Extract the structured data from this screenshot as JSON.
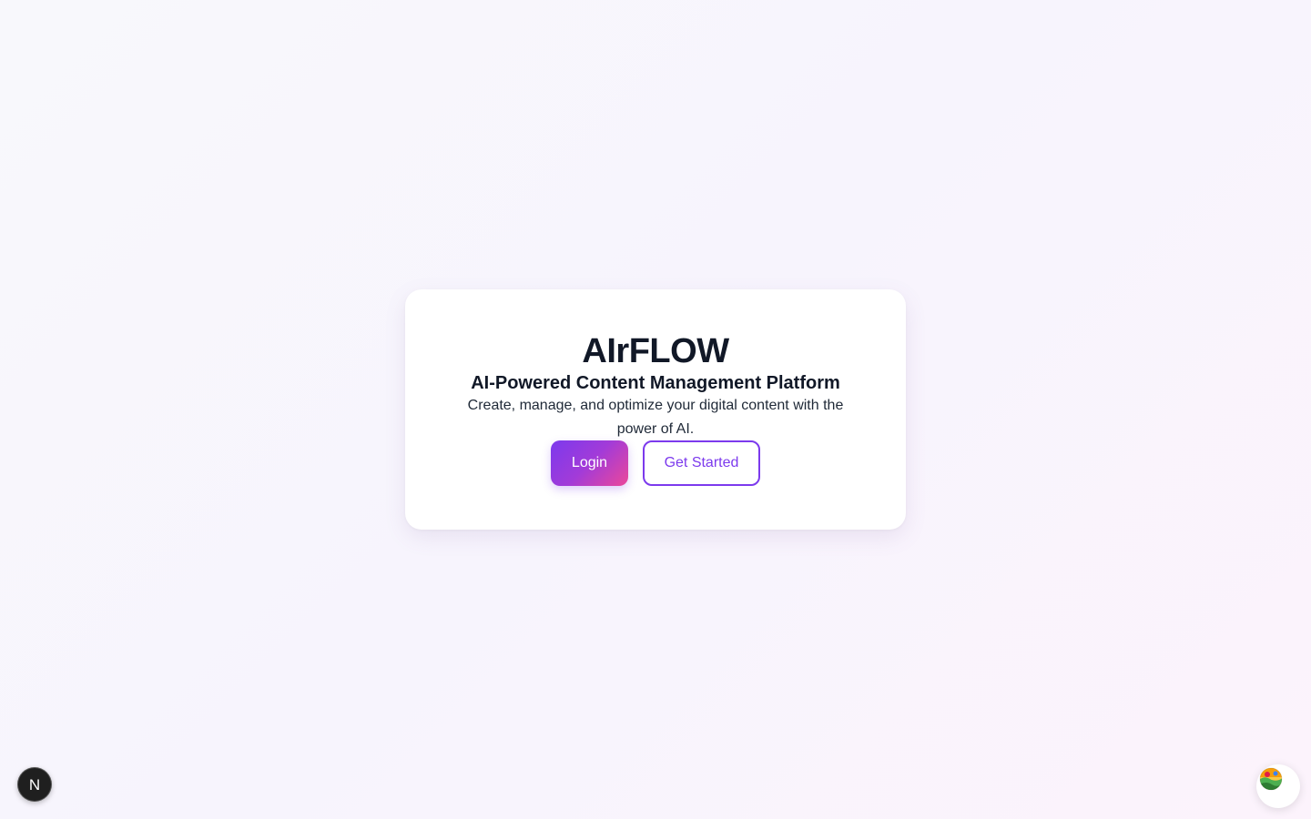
{
  "hero": {
    "brand": "AIrFLOW",
    "tagline": "AI-Powered Content Management Platform",
    "description": "Create, manage, and optimize your digital content with the power of AI."
  },
  "actions": {
    "login_label": "Login",
    "get_started_label": "Get Started"
  },
  "dev_badge": {
    "letter": "N",
    "icon": "nextjs-logo-icon"
  },
  "floating_widget": {
    "icon": "landscape-globe-icon"
  },
  "colors": {
    "accent_purple": "#7c3aed",
    "accent_pink": "#ec4899",
    "text_dark": "#111827"
  }
}
